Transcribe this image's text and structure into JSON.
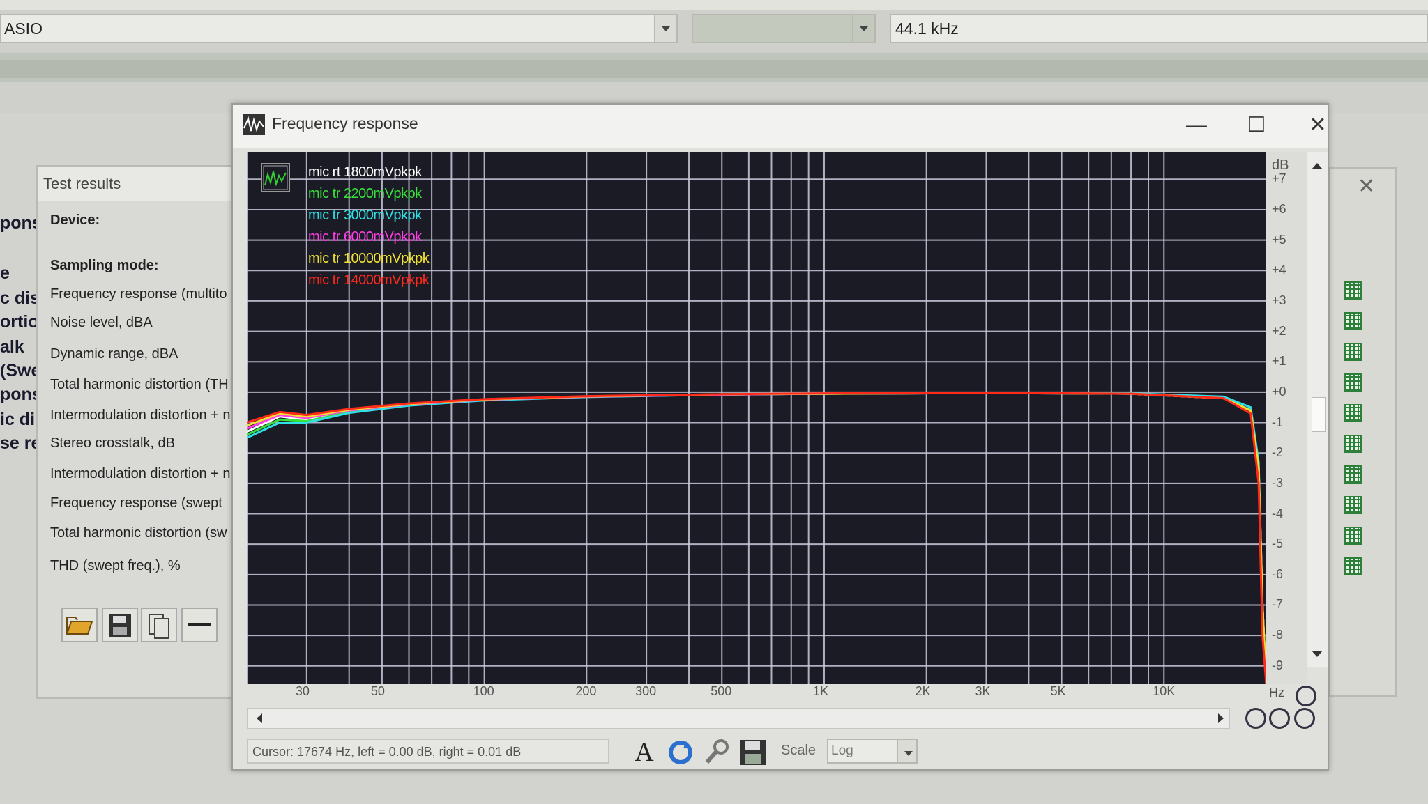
{
  "topbar": {
    "driver_value": "ASIO",
    "rate_value": "44.1 kHz",
    "middle_value": ""
  },
  "left_cut_words": [
    "pons",
    "e",
    "c dist",
    "ortio",
    "alk",
    "(Swe",
    "pons",
    "ic dist",
    "se res"
  ],
  "test_results": {
    "title": "Test results",
    "items": [
      "Device:",
      "Sampling mode:",
      "Frequency response (multito",
      "Noise level, dBA",
      "Dynamic range, dBA",
      "Total harmonic distortion (TH",
      "Intermodulation distortion + n",
      "Stereo crosstalk, dB",
      "Intermodulation distortion + n",
      "Frequency response (swept",
      "Total harmonic distortion (sw",
      "THD (swept freq.), %"
    ]
  },
  "freq_window": {
    "title": "Frequency response",
    "minimize": "—",
    "maximize": "☐",
    "close": "✕",
    "db_unit": "dB",
    "hz_unit": "Hz",
    "cursor_text": "Cursor:  17674 Hz,  left = 0.00 dB,  right = 0.01 dB",
    "scale_label": "Scale",
    "scale_value": "Log"
  },
  "colors": {
    "plot_bg": "#1b1b26",
    "grid": "#c9ccde",
    "series": [
      "#ffffff",
      "#37e13a",
      "#2fe0e6",
      "#ff3ee6",
      "#f0e232",
      "#ff2a1a"
    ]
  },
  "chart_data": {
    "type": "line",
    "x_scale": "log",
    "xlim": [
      20,
      20000
    ],
    "ylim": [
      -9.6,
      7.9
    ],
    "x_ticks": [
      "30",
      "50",
      "100",
      "200",
      "300",
      "500",
      "1K",
      "2K",
      "3K",
      "5K",
      "10K"
    ],
    "x_tick_values": [
      30,
      50,
      100,
      200,
      300,
      500,
      1000,
      2000,
      3000,
      5000,
      10000
    ],
    "y_ticks": [
      "+7",
      "+6",
      "+5",
      "+4",
      "+3",
      "+2",
      "+1",
      "+0",
      "-1",
      "-2",
      "-3",
      "-4",
      "-5",
      "-6",
      "-7",
      "-8",
      "-9"
    ],
    "y_tick_values": [
      7,
      6,
      5,
      4,
      3,
      2,
      1,
      0,
      -1,
      -2,
      -3,
      -4,
      -5,
      -6,
      -7,
      -8,
      -9
    ],
    "series": [
      {
        "name": "mic rt 1800mVpkpk",
        "x": [
          20,
          25,
          30,
          40,
          60,
          100,
          200,
          500,
          1000,
          3000,
          8000,
          15000,
          18000,
          19000,
          19500,
          20000
        ],
        "y": [
          -1.3,
          -0.8,
          -0.9,
          -0.6,
          -0.4,
          -0.25,
          -0.15,
          -0.08,
          -0.05,
          -0.03,
          -0.05,
          -0.2,
          -0.6,
          -2.5,
          -7,
          -9.6
        ]
      },
      {
        "name": "mic tr 2200mVpkpk",
        "x": [
          20,
          25,
          30,
          40,
          60,
          100,
          200,
          500,
          1000,
          3000,
          8000,
          15000,
          18000,
          19000,
          19500,
          20000
        ],
        "y": [
          -1.4,
          -0.9,
          -0.95,
          -0.65,
          -0.42,
          -0.26,
          -0.15,
          -0.08,
          -0.05,
          -0.03,
          -0.05,
          -0.2,
          -0.6,
          -2.5,
          -7,
          -9.6
        ]
      },
      {
        "name": "mic tr 3000mVpkpk",
        "x": [
          20,
          25,
          30,
          40,
          60,
          100,
          200,
          500,
          1000,
          3000,
          8000,
          15000,
          18000,
          19000,
          19500,
          20000
        ],
        "y": [
          -1.5,
          -1.0,
          -1.0,
          -0.68,
          -0.44,
          -0.27,
          -0.16,
          -0.08,
          -0.05,
          -0.03,
          -0.04,
          -0.15,
          -0.5,
          -2.3,
          -7,
          -9.6
        ]
      },
      {
        "name": "mic tr 6000mVpkpk",
        "x": [
          20,
          25,
          30,
          40,
          60,
          100,
          200,
          500,
          1000,
          3000,
          8000,
          15000,
          18000,
          19000,
          19500,
          20000
        ],
        "y": [
          -1.2,
          -0.75,
          -0.85,
          -0.6,
          -0.4,
          -0.25,
          -0.15,
          -0.08,
          -0.05,
          -0.03,
          -0.05,
          -0.2,
          -0.6,
          -2.5,
          -7,
          -9.6
        ]
      },
      {
        "name": "mic tr 10000mVpkpk",
        "x": [
          20,
          25,
          30,
          40,
          60,
          100,
          200,
          500,
          1000,
          3000,
          8000,
          15000,
          18000,
          19000,
          19500,
          20000
        ],
        "y": [
          -1.1,
          -0.7,
          -0.8,
          -0.58,
          -0.39,
          -0.24,
          -0.14,
          -0.07,
          -0.05,
          -0.03,
          -0.05,
          -0.2,
          -0.6,
          -2.5,
          -7,
          -9.6
        ]
      },
      {
        "name": "mic tr 14000mVpkpk",
        "x": [
          20,
          25,
          30,
          40,
          60,
          100,
          200,
          500,
          1000,
          3000,
          8000,
          15000,
          18000,
          19000,
          19500,
          20000
        ],
        "y": [
          -1.0,
          -0.65,
          -0.75,
          -0.55,
          -0.37,
          -0.23,
          -0.13,
          -0.07,
          -0.04,
          -0.02,
          -0.05,
          -0.2,
          -0.7,
          -3.0,
          -8,
          -9.6
        ]
      }
    ]
  }
}
